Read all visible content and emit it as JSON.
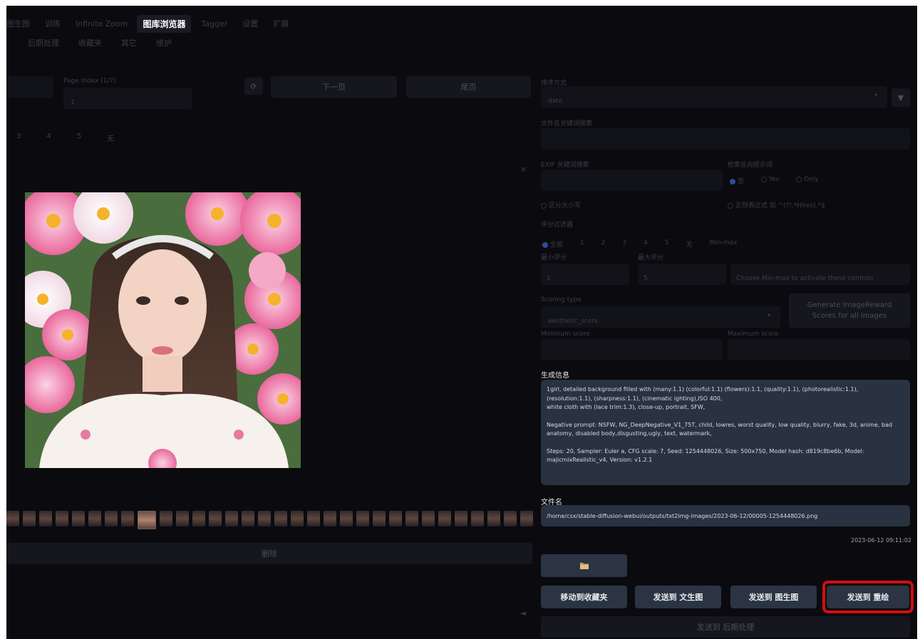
{
  "top_tabs": [
    "图生图",
    "训练",
    "Infinite Zoom",
    "图库浏览器",
    "Tagger",
    "设置",
    "扩展"
  ],
  "active_top_tab": "图库浏览器",
  "sub_tabs": [
    "后期处理",
    "收藏夹",
    "其它",
    "维护"
  ],
  "pager": {
    "page_index_label": "Page Index (1/7)",
    "page_index_value": "1",
    "next_label": "下一页",
    "last_label": "尾页",
    "page_tabs": [
      "3",
      "4",
      "5",
      "无"
    ]
  },
  "sort": {
    "label": "排序方式",
    "value": "date"
  },
  "filename_search": {
    "label": "文件名关键词搜索"
  },
  "exif": {
    "label": "EXIF 关键词搜索",
    "case_label": "区分大小写",
    "neg_label": "检索反向提示词",
    "neg_options": [
      "否",
      "Yes",
      "Only"
    ],
    "regex_label": "正则表达式 如 ^(?!.*Hires).*$"
  },
  "ranking": {
    "label": "评分过滤器",
    "options": [
      "全部",
      "1",
      "2",
      "3",
      "4",
      "5",
      "无",
      "Min-max"
    ],
    "min_label": "最小评分",
    "min_value": "1",
    "max_label": "最大评分",
    "max_value": "5",
    "hint": "Choose Min-max to activate these controls"
  },
  "scoring": {
    "type_label": "Scoring type",
    "type_value": "aesthetic_score",
    "generate_label": "Generate ImageReward Scores for all images",
    "min_label": "Minimum score",
    "max_label": "Maximum score"
  },
  "delete_label": "删除",
  "gen_info": {
    "label": "生成信息",
    "prompt": "1girl, detailed background filled with (many:1.1) (colorful:1.1) (flowers):1.1, (quality:1.1), (photorealistic:1.1), (resolution:1.1), (sharpness:1.1), (cinematic ighting),ISO 400,",
    "prompt_line2": "white cloth with (lace trim:1.3), close-up, portrait, SFW,",
    "negative": "Negative prompt: NSFW, NG_DeepNegative_V1_75T, child, lowres, worst quality, low quality, blurry, fake, 3d, anime, bad anatomy, disabled body,disgusting,ugly, text, watermark,",
    "params": "Steps: 20, Sampler: Euler a, CFG scale: 7, Seed: 1254448026, Size: 500x750, Model hash: d819c8be6b, Model: majicmixRealistic_v4, Version: v1.2.1"
  },
  "filename": {
    "label": "文件名",
    "value": "/home/csx/stable-diffusion-webui/outputs/txt2img-images/2023-06-12/00005-1254448026.png"
  },
  "timestamp": "2023-06-12 09:11:02",
  "actions": {
    "move_fav": "移动到收藏夹",
    "send_txt2img": "发送到 文生图",
    "send_img2img": "发送到 图生图",
    "send_inpaint": "发送到 重绘",
    "send_extras": "发送到 后期处理"
  },
  "colors": {
    "accent_highlight": "#d10f13",
    "panel": "#283241",
    "bg": "#0b0b0f"
  }
}
